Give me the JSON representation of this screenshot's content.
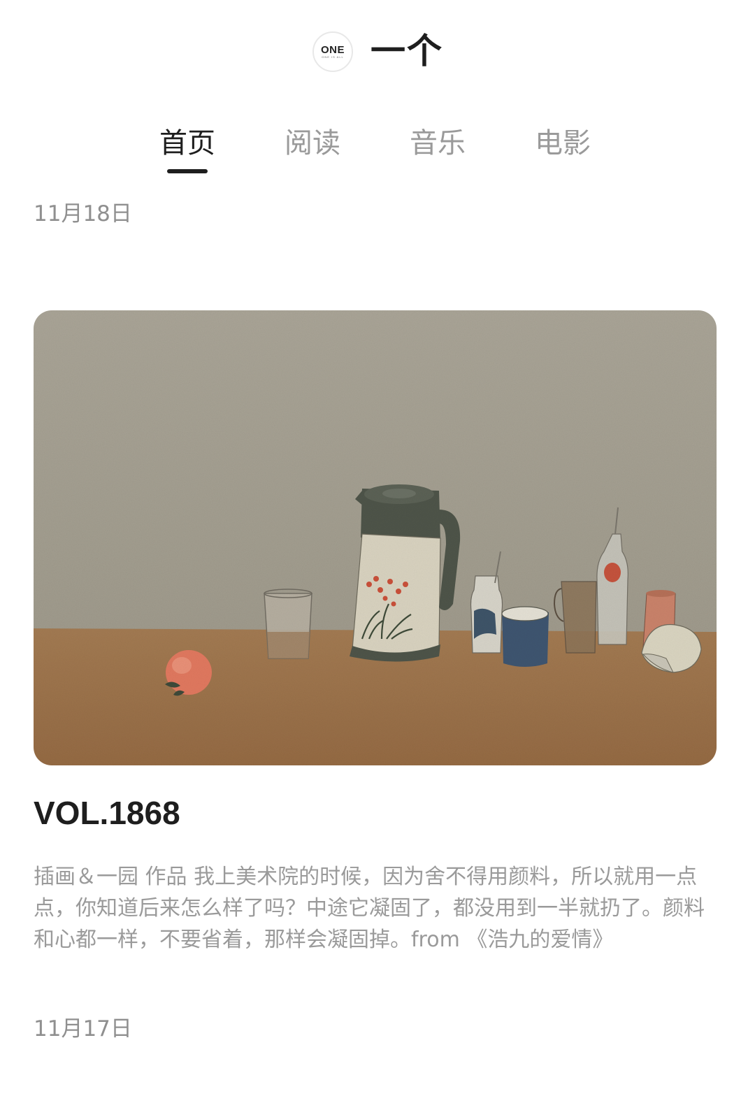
{
  "header": {
    "logo_text": "ONE",
    "logo_sub": "ONE IS ALL",
    "title": "一个"
  },
  "tabs": [
    {
      "label": "首页",
      "active": true
    },
    {
      "label": "阅读",
      "active": false
    },
    {
      "label": "音乐",
      "active": false
    },
    {
      "label": "电影",
      "active": false
    }
  ],
  "feed": {
    "date_1": "11月18日",
    "volume": "VOL.1868",
    "description": "插画＆一园 作品 我上美术院的时候，因为舍不得用颜料，所以就用一点点，你知道后来怎么样了吗？中途它凝固了，都没用到一半就扔了。颜料和心都一样，不要省着，那样会凝固掉。from 《浩九的爱情》",
    "date_2": "11月17日"
  },
  "colors": {
    "text_primary": "#1e1e1e",
    "text_secondary": "#9a9a9a",
    "wall": "#a8a395",
    "table": "#9a7048"
  }
}
